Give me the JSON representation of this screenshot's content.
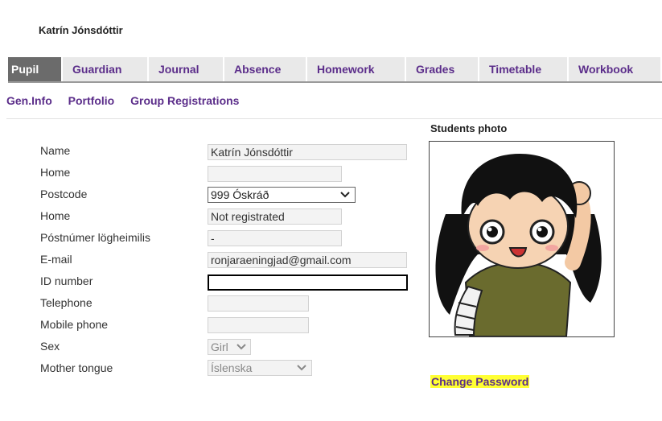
{
  "header": {
    "student_name": "Katrín Jónsdóttir"
  },
  "tabs": [
    {
      "label": "Pupil",
      "active": true
    },
    {
      "label": "Guardian"
    },
    {
      "label": "Journal"
    },
    {
      "label": "Absence"
    },
    {
      "label": "Homework"
    },
    {
      "label": "Grades"
    },
    {
      "label": "Timetable"
    },
    {
      "label": "Workbook"
    }
  ],
  "subnav": [
    "Gen.Info",
    "Portfolio",
    "Group Registrations"
  ],
  "form": {
    "name": {
      "label": "Name",
      "value": "Katrín Jónsdóttir"
    },
    "home": {
      "label": "Home",
      "value": ""
    },
    "postcode": {
      "label": "Postcode",
      "value": "999 Óskráð"
    },
    "home2": {
      "label": "Home",
      "value": "Not registrated"
    },
    "postnumer": {
      "label": "Póstnúmer lögheimilis",
      "value": "-"
    },
    "email": {
      "label": "E-mail",
      "value": "ronjaraeningjad@gmail.com"
    },
    "id_number": {
      "label": "ID number",
      "value": ""
    },
    "telephone": {
      "label": "Telephone",
      "value": ""
    },
    "mobile": {
      "label": "Mobile phone",
      "value": ""
    },
    "sex": {
      "label": "Sex",
      "value": "Girl"
    },
    "mother_tongue": {
      "label": "Mother tongue",
      "value": "Íslenska"
    }
  },
  "photo": {
    "title": "Students photo"
  },
  "actions": {
    "change_password": "Change Password"
  },
  "colors": {
    "accent": "#5b2d8a",
    "active_tab": "#6b6b6b",
    "highlight": "#ffff33"
  }
}
